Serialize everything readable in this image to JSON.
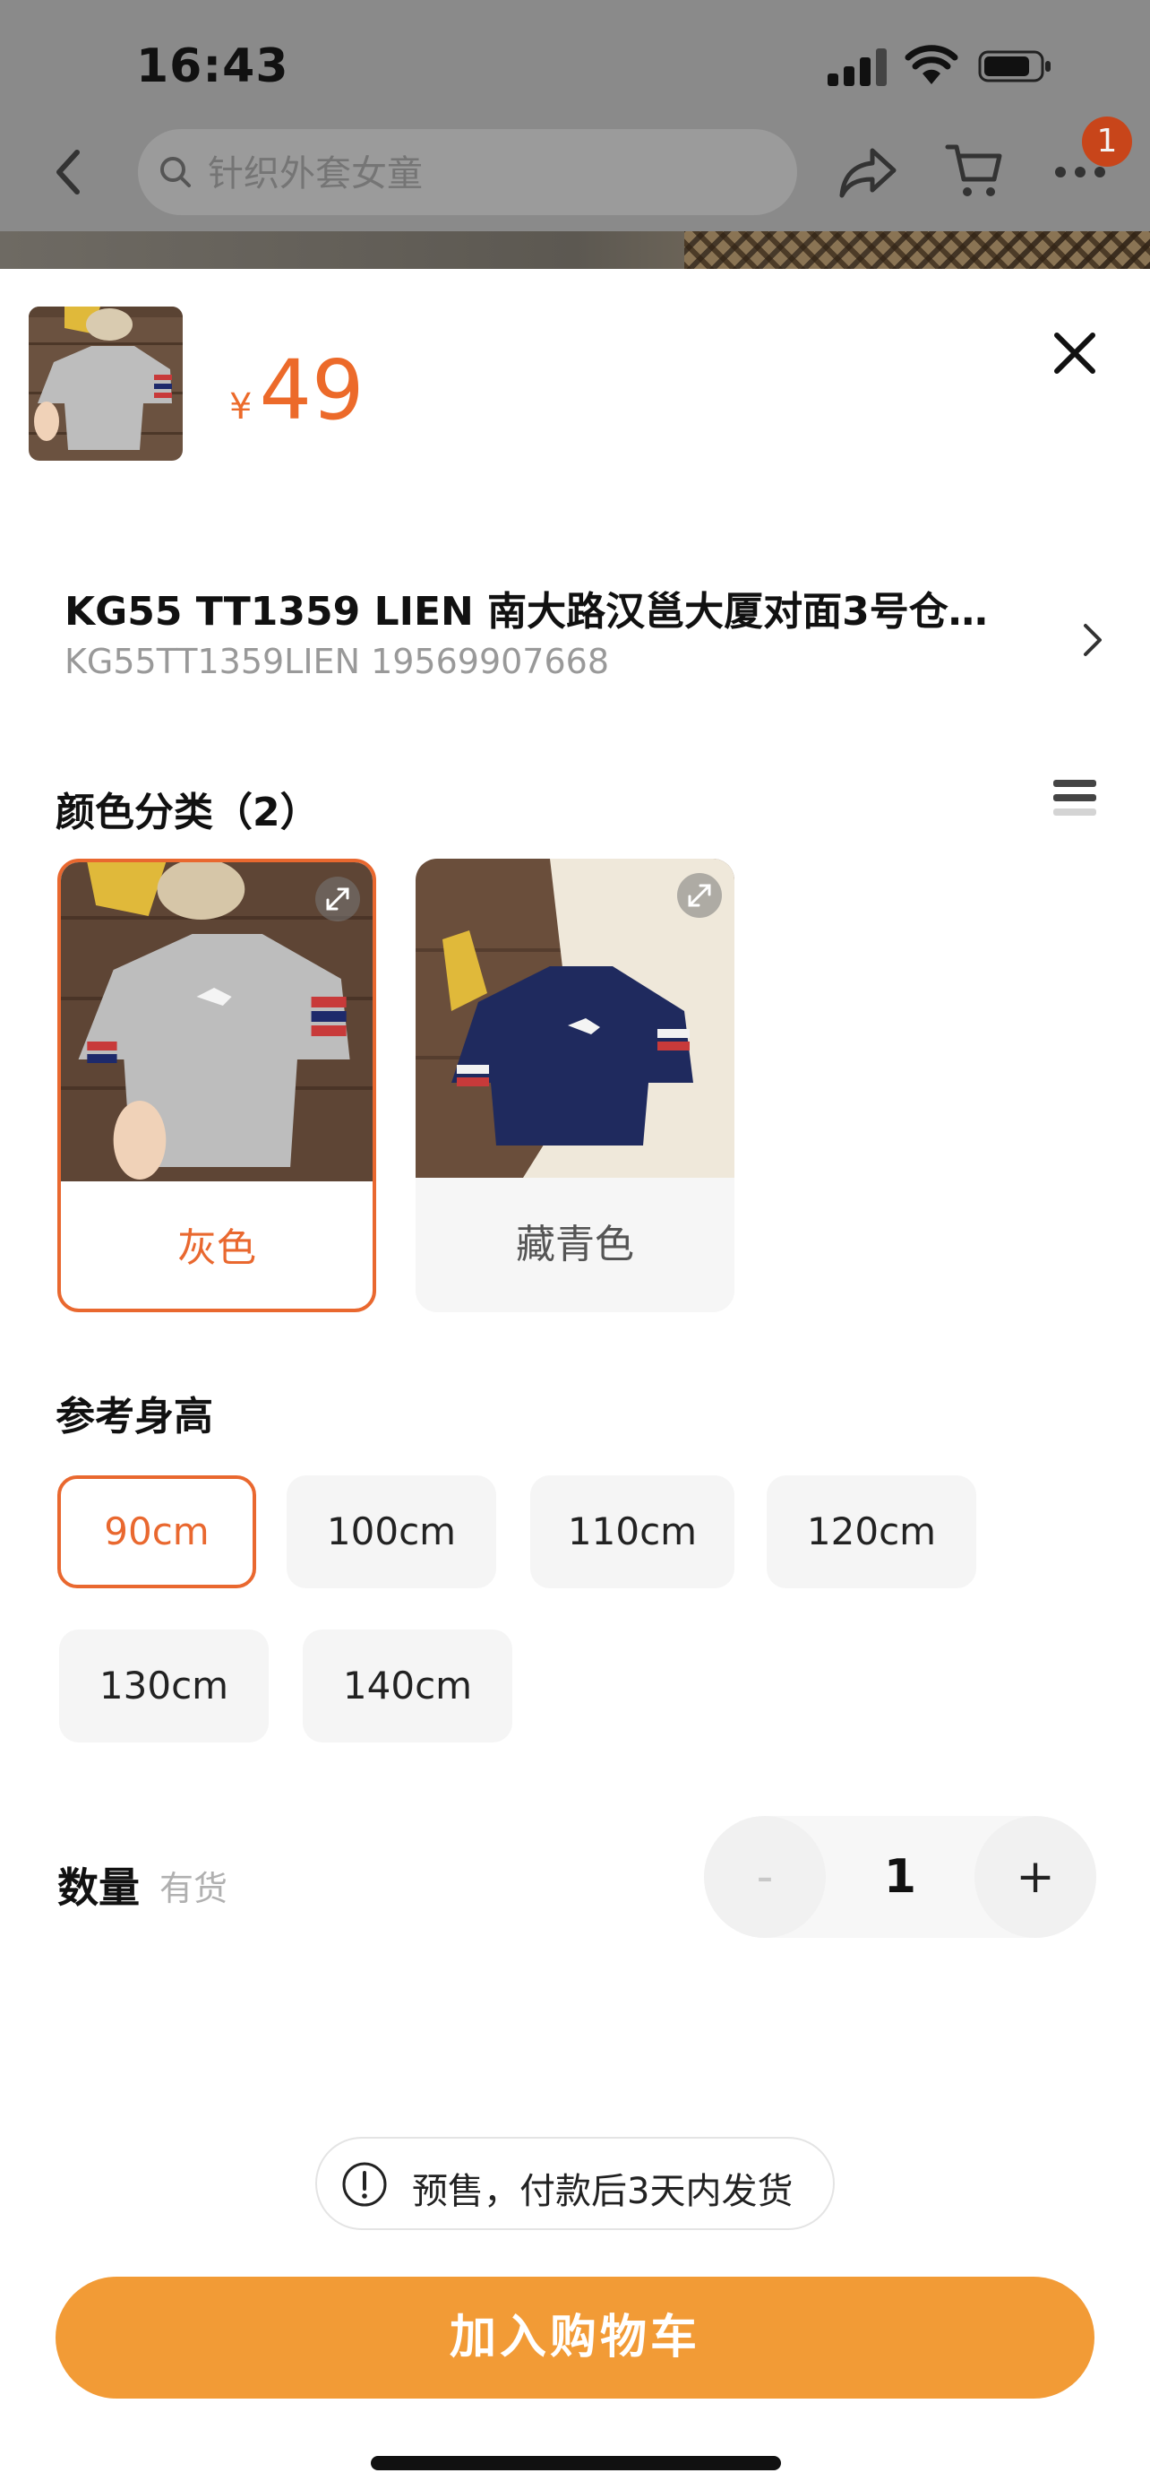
{
  "status_bar": {
    "time": "16:43"
  },
  "nav": {
    "search_placeholder": "针织外套女童",
    "badge_count": "1"
  },
  "product": {
    "currency": "¥",
    "price": "49"
  },
  "shop": {
    "name": "KG55 TT1359 LIEN  南大路汉邕大厦对面3号仓…",
    "sub": "KG55TT1359LIEN 19569907668"
  },
  "color_section": {
    "title": "颜色分类（2）",
    "options": [
      {
        "label": "灰色",
        "selected": true
      },
      {
        "label": "藏青色",
        "selected": false
      }
    ]
  },
  "size_section": {
    "title": "参考身高",
    "options": [
      {
        "label": "90cm",
        "selected": true
      },
      {
        "label": "100cm",
        "selected": false
      },
      {
        "label": "110cm",
        "selected": false
      },
      {
        "label": "120cm",
        "selected": false
      },
      {
        "label": "130cm",
        "selected": false
      },
      {
        "label": "140cm",
        "selected": false
      }
    ]
  },
  "quantity": {
    "label": "数量",
    "stock": "有货",
    "minus": "-",
    "value": "1",
    "plus": "+"
  },
  "presale_notice": "预售，付款后3天内发货",
  "add_to_cart_label": "加入购物车",
  "colors": {
    "accent": "#e9682f",
    "price": "#ec6a2a",
    "cta": "#f29b36"
  }
}
